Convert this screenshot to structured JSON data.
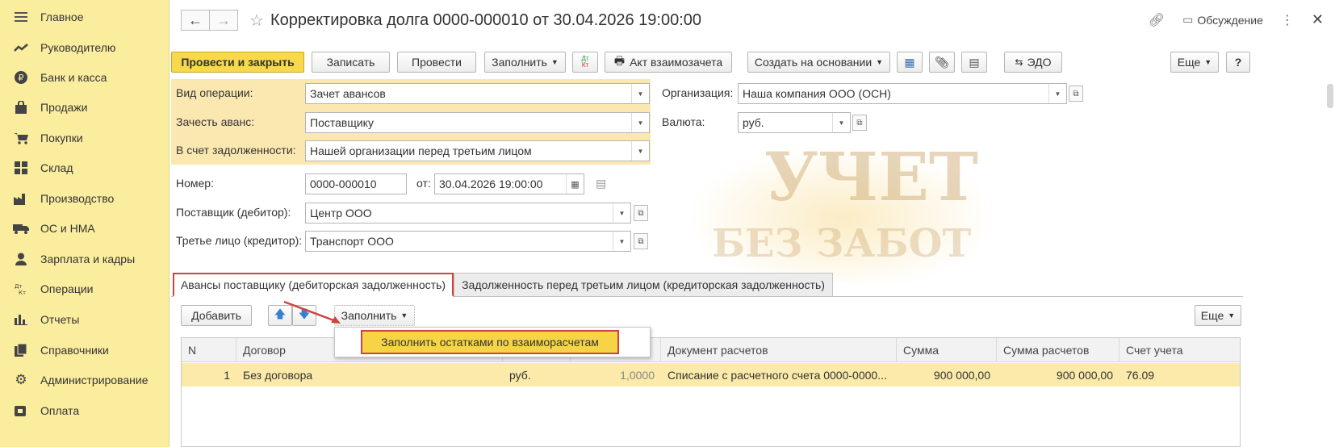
{
  "sidebar": {
    "items": [
      {
        "label": "Главное",
        "icon": "menu-icon"
      },
      {
        "label": "Руководителю",
        "icon": "trend-icon"
      },
      {
        "label": "Банк и касса",
        "icon": "ruble-coin-icon"
      },
      {
        "label": "Продажи",
        "icon": "shopping-bag-icon"
      },
      {
        "label": "Покупки",
        "icon": "cart-icon"
      },
      {
        "label": "Склад",
        "icon": "warehouse-icon"
      },
      {
        "label": "Производство",
        "icon": "factory-icon"
      },
      {
        "label": "ОС и НМА",
        "icon": "truck-icon"
      },
      {
        "label": "Зарплата и кадры",
        "icon": "person-icon"
      },
      {
        "label": "Операции",
        "icon": "dt-kt-icon"
      },
      {
        "label": "Отчеты",
        "icon": "bar-chart-icon"
      },
      {
        "label": "Справочники",
        "icon": "books-icon"
      },
      {
        "label": "Администрирование",
        "icon": "gear-icon"
      },
      {
        "label": "Оплата",
        "icon": "payment-icon"
      }
    ]
  },
  "header": {
    "title": "Корректировка долга 0000-000010 от 30.04.2026 19:00:00",
    "discussion_label": "Обсуждение"
  },
  "toolbar": {
    "post_close": "Провести и закрыть",
    "save": "Записать",
    "post": "Провести",
    "fill": "Заполнить",
    "act": "Акт взаимозачета",
    "create_based": "Создать на основании",
    "edo": "ЭДО",
    "more": "Еще",
    "help": "?"
  },
  "form": {
    "operation_type_label": "Вид операции:",
    "operation_type_value": "Зачет авансов",
    "offset_advance_label": "Зачесть аванс:",
    "offset_advance_value": "Поставщику",
    "debt_label": "В счет задолженности:",
    "debt_value": "Нашей организации перед третьим лицом",
    "organization_label": "Организация:",
    "organization_value": "Наша компания ООО (ОСН)",
    "currency_label": "Валюта:",
    "currency_value": "руб.",
    "number_label": "Номер:",
    "number_value": "0000-000010",
    "date_label": "от:",
    "date_value": "30.04.2026 19:00:00",
    "supplier_label": "Поставщик (дебитор):",
    "supplier_value": "Центр ООО",
    "third_party_label": "Третье лицо (кредитор):",
    "third_party_value": "Транспорт ООО"
  },
  "tabs": [
    {
      "label": "Авансы поставщику (дебиторская задолженность)",
      "active": true
    },
    {
      "label": "Задолженность перед третьим лицом (кредиторская задолженность)",
      "active": false
    }
  ],
  "table_toolbar": {
    "add": "Добавить",
    "fill": "Заполнить",
    "more": "Еще"
  },
  "popup": {
    "item": "Заполнить остатками по взаиморасчетам"
  },
  "table": {
    "columns": [
      "N",
      "Договор",
      "",
      "",
      "Документ расчетов",
      "Сумма",
      "Сумма расчетов",
      "Счет учета"
    ],
    "rows": [
      [
        "1",
        "Без договора",
        "руб.",
        "1,0000",
        "Списание с расчетного счета 0000-0000...",
        "900 000,00",
        "900 000,00",
        "76.09"
      ]
    ]
  },
  "watermark": {
    "line1": "УЧЕТ",
    "line2": "БЕЗ ЗАБОТ"
  },
  "colors": {
    "sidebar_bg": "#fbed9e",
    "primary_button": "#f8d94b",
    "highlight_red": "#d0443f",
    "row_selected": "#fbeaa9"
  }
}
